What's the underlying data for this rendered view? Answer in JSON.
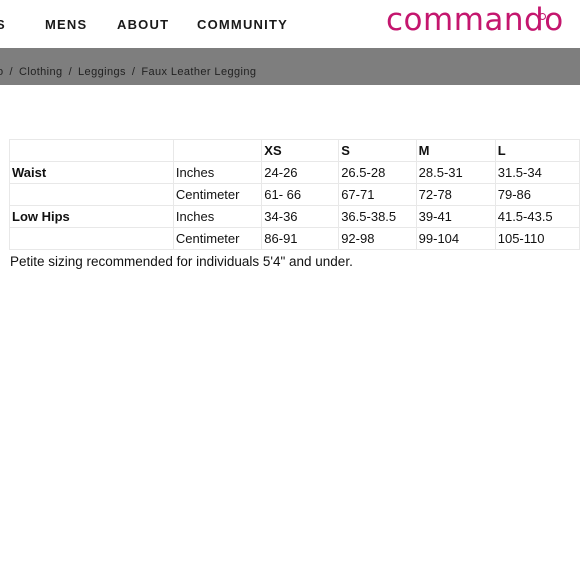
{
  "nav": {
    "partial_item": "S",
    "items": [
      {
        "label": "MENS"
      },
      {
        "label": "ABOUT"
      },
      {
        "label": "COMMUNITY"
      }
    ]
  },
  "brand": {
    "name": "commando",
    "color": "#c4166e"
  },
  "breadcrumb": {
    "bar_color": "#7e7e7e",
    "items": [
      "o",
      "Clothing",
      "Leggings",
      "Faux Leather Legging"
    ],
    "separator": "/"
  },
  "size_table": {
    "header": [
      "",
      "",
      "XS",
      "S",
      "M",
      "L"
    ],
    "rows": [
      [
        "Waist",
        "Inches",
        "24-26",
        "26.5-28",
        "28.5-31",
        "31.5-34"
      ],
      [
        "",
        "Centimeter",
        "61- 66",
        "67-71",
        "72-78",
        "79-86"
      ],
      [
        "Low Hips",
        "Inches",
        "34-36",
        "36.5-38.5",
        "39-41",
        "41.5-43.5"
      ],
      [
        "",
        "Centimeter",
        "86-91",
        "92-98",
        "99-104",
        "105-110"
      ]
    ]
  },
  "note": "Petite sizing recommended for individuals 5'4\" and under."
}
